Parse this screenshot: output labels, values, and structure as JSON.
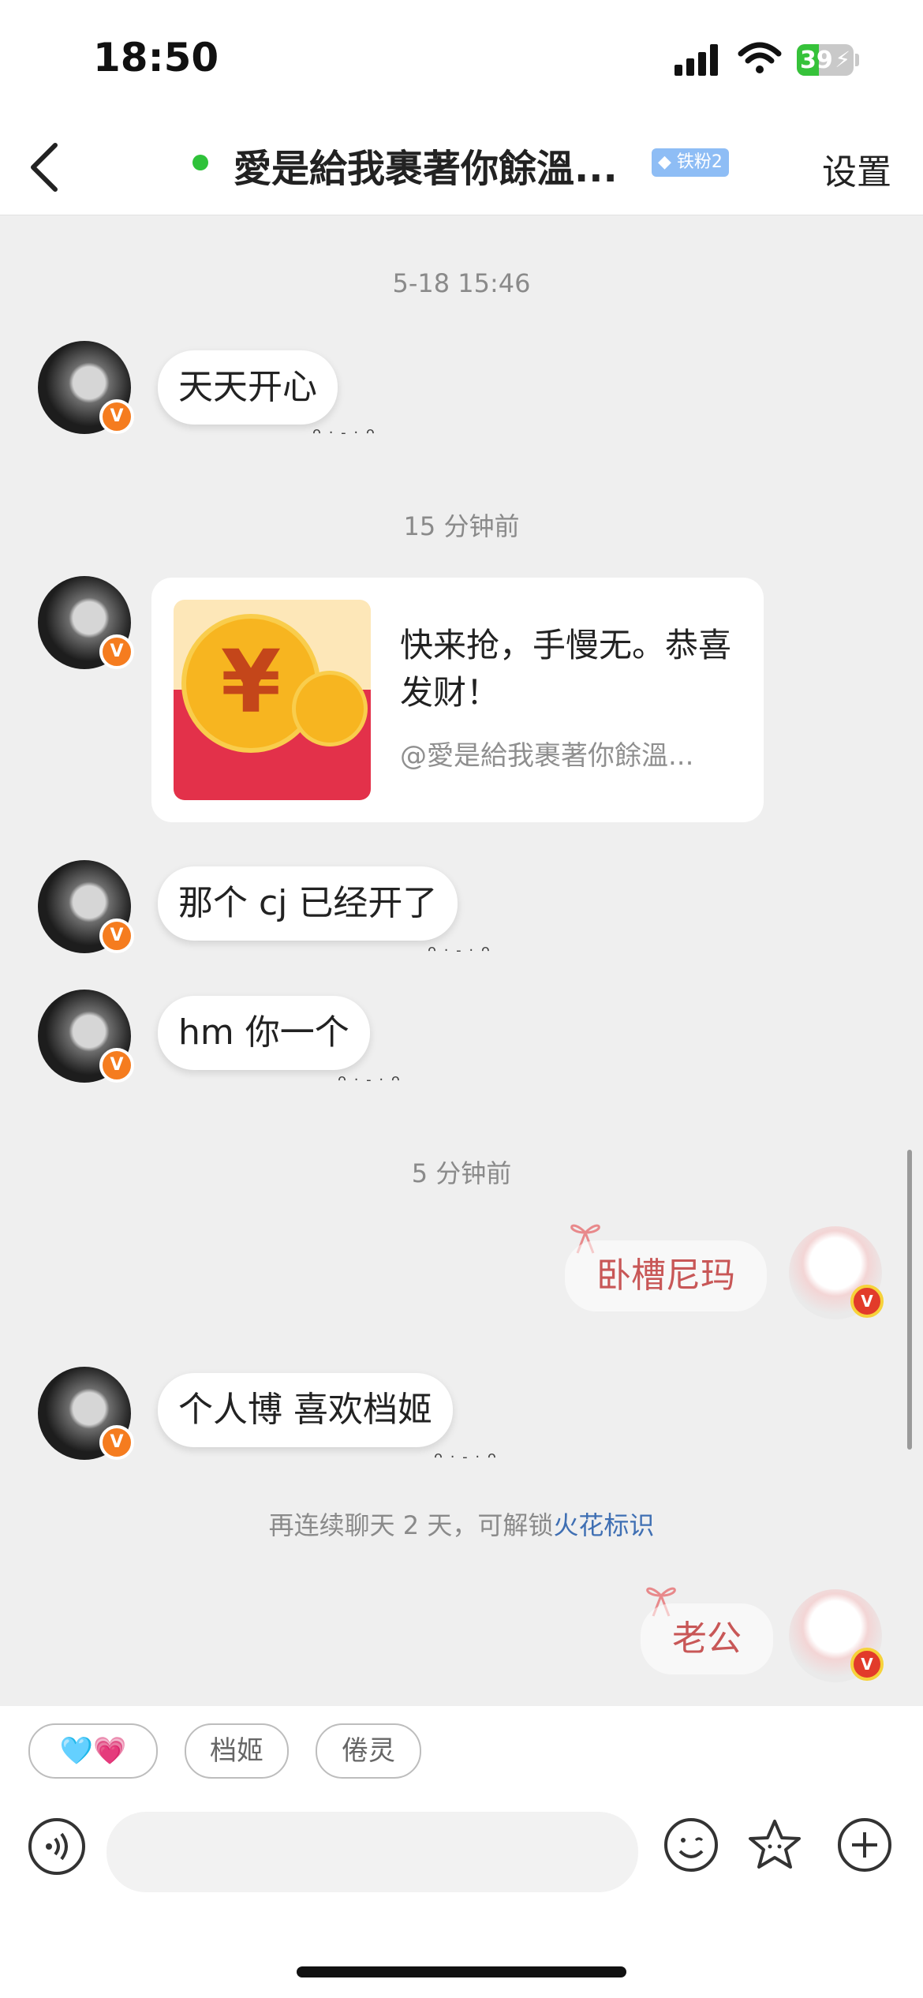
{
  "status_bar": {
    "time": "18:50",
    "battery": "39",
    "battery_level": 0.39
  },
  "header": {
    "title": "愛是給我裹著你餘溫...",
    "fan_badge": "◆ 铁粉2",
    "settings": "设置"
  },
  "messages": {
    "ts1": "5-18 15:46",
    "m1": "天天开心",
    "ts2": "15 分钟前",
    "redpack_text": "快来抢，手慢无。恭喜发财！",
    "redpack_from": "@愛是給我裹著你餘溫...",
    "m2": "那个 cj 已经开了",
    "m3": "hm 你一个",
    "ts3": "5 分钟前",
    "mine1": "卧槽尼玛",
    "m4": "个人博 喜欢档姬",
    "hint_prefix": "再连续聊天 2 天，可解锁",
    "hint_link": "火花标识",
    "mine2": "老公",
    "ears": "ᴖ · - · ᴖ",
    "avatar_badge": "V"
  },
  "quick_replies": [
    "🩵💗",
    "档姬",
    "倦灵"
  ],
  "icons": {
    "back": "chevron-left-icon",
    "voice": "voice-icon",
    "emoji": "emoji-icon",
    "sticker": "star-sticker-icon",
    "plus": "plus-icon"
  },
  "colors": {
    "online": "#2fc23a",
    "badge": "#f57c1f",
    "link": "#3f6fb3",
    "redpack": "#e3314a"
  }
}
